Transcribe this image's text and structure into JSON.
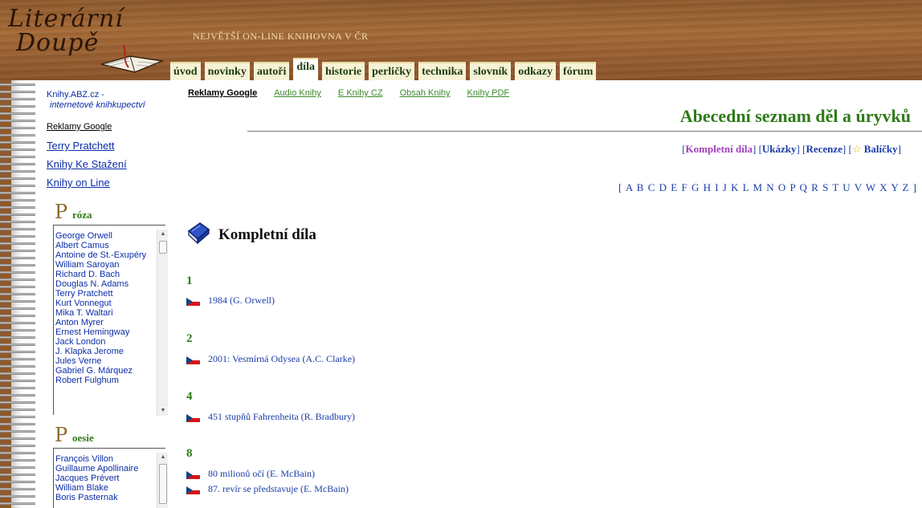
{
  "header": {
    "logo_text_1": "Literární",
    "logo_text_2": "Doupě",
    "tagline": "NEJVĚTŠÍ ON-LINE KNIHOVNA V ČR",
    "nav": [
      "úvod",
      "novinky",
      "autoři",
      "díla",
      "historie",
      "perličky",
      "technika",
      "slovník",
      "odkazy",
      "fórum"
    ],
    "active_nav": "díla"
  },
  "sidebar": {
    "site_name": "Knihy.ABZ.cz -",
    "site_tag": "internetové knihkupectví",
    "ads_label": "Reklamy Google",
    "links": [
      "Terry Pratchett",
      "Knihy Ke Stažení",
      "Knihy on Line"
    ],
    "proza": {
      "initial": "P",
      "rest": "róza",
      "items": [
        "George Orwell",
        "Albert Camus",
        "Antoine de St.-Exupéry",
        "William Saroyan",
        "Richard D. Bach",
        "Douglas N. Adams",
        "Terry Pratchett",
        "Kurt Vonnegut",
        "Mika T. Waltari",
        "Anton Myrer",
        "Ernest Hemingway",
        "Jack London",
        "J. Klapka Jerome",
        "Jules Verne",
        "Gabriel G. Márquez",
        "Robert Fulghum"
      ]
    },
    "poezie": {
      "initial": "P",
      "rest": "oesie",
      "items": [
        "François Villon",
        "Guillaume Apollinaire",
        "Jacques Prévert",
        "William Blake",
        "Boris Pasternak"
      ]
    }
  },
  "main": {
    "top_links": [
      "Reklamy Google",
      "Audio Knihy",
      "E Knihy CZ",
      "Obsah Knihy",
      "Knihy PDF"
    ],
    "title": "Abecední seznam děl a úryvků",
    "filters": {
      "kompletni": "Kompletní díla",
      "ukazky": "Ukázky",
      "recenze": "Recenze",
      "balicky": "Balíčky"
    },
    "alphabet": "[ A B C D E F G H I J K L M N O P Q R S T U V W X Y Z ]",
    "section_title": "Kompletní díla",
    "groups": [
      {
        "head": "1",
        "entries": [
          {
            "title": "1984",
            "author": "(G. Orwell)"
          }
        ]
      },
      {
        "head": "2",
        "entries": [
          {
            "title": "2001: Vesmírná Odysea",
            "author": "(A.C. Clarke)"
          }
        ]
      },
      {
        "head": "4",
        "entries": [
          {
            "title": "451 stupňů Fahrenheita",
            "author": "(R. Bradbury)"
          }
        ]
      },
      {
        "head": "8",
        "entries": [
          {
            "title": "80 milionů očí",
            "author": "(E. McBain)"
          },
          {
            "title": "87. revír se představuje",
            "author": "(E. McBain)"
          }
        ]
      }
    ]
  },
  "colors": {
    "accent_green": "#2e7a19",
    "link_blue": "#1b3da8",
    "wood": "#8e5a2c",
    "active_filter": "#a03dbd"
  }
}
